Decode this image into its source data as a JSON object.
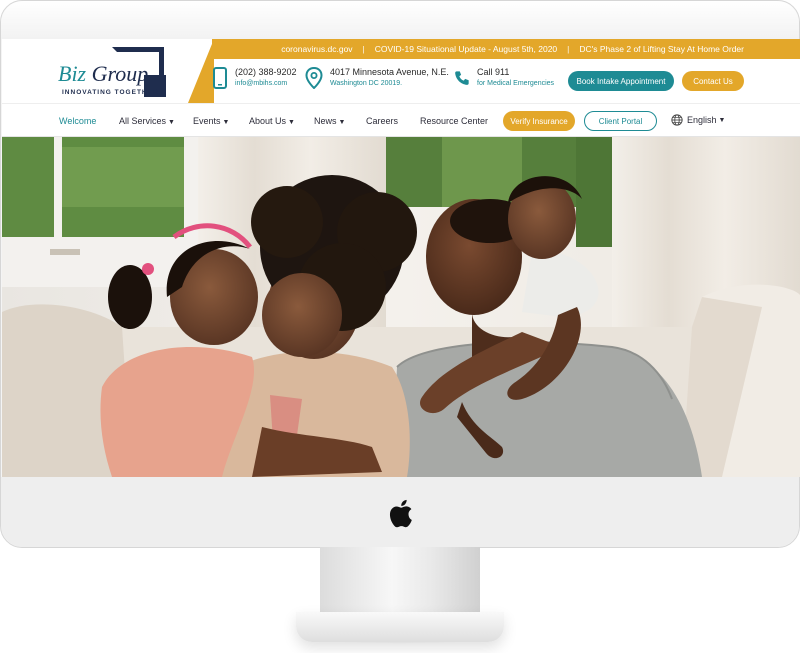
{
  "brand": {
    "logo_biz": "Biz",
    "logo_group": "Group",
    "tagline": "INNOVATING TOGETHER"
  },
  "topbar": {
    "items": [
      "coronavirus.dc.gov",
      "COVID-19 Situational Update - August 5th, 2020",
      "DC's Phase 2 of Lifting Stay At Home Order"
    ],
    "separator": "|"
  },
  "contacts": {
    "phone": {
      "icon": "phone-icon",
      "line1": "(202) 388-9202",
      "line2": "info@mbihs.com"
    },
    "address": {
      "icon": "location-pin-icon",
      "line1": "4017 Minnesota Avenue, N.E.",
      "line2": "Washington DC 20019."
    },
    "emergency": {
      "icon": "phone-handset-icon",
      "line1": "Call 911",
      "line2": "for Medical Emergencies"
    }
  },
  "header_buttons": {
    "book": "Book Intake Appointment",
    "contact": "Contact Us"
  },
  "nav": {
    "items": [
      {
        "label": "Welcome",
        "caret": false,
        "active": true
      },
      {
        "label": "All Services",
        "caret": true
      },
      {
        "label": "Events",
        "caret": true
      },
      {
        "label": "About Us",
        "caret": true
      },
      {
        "label": "News",
        "caret": true
      },
      {
        "label": "Careers",
        "caret": false
      },
      {
        "label": "Resource Center",
        "caret": false
      }
    ],
    "verify": "Verify Insurance",
    "portal": "Client Portal",
    "language": "English",
    "language_icon": "globe-icon"
  },
  "hero": {
    "image": "family-photo"
  },
  "colors": {
    "teal": "#1e8b94",
    "gold": "#e3a72a",
    "navy": "#1f2d4e"
  }
}
